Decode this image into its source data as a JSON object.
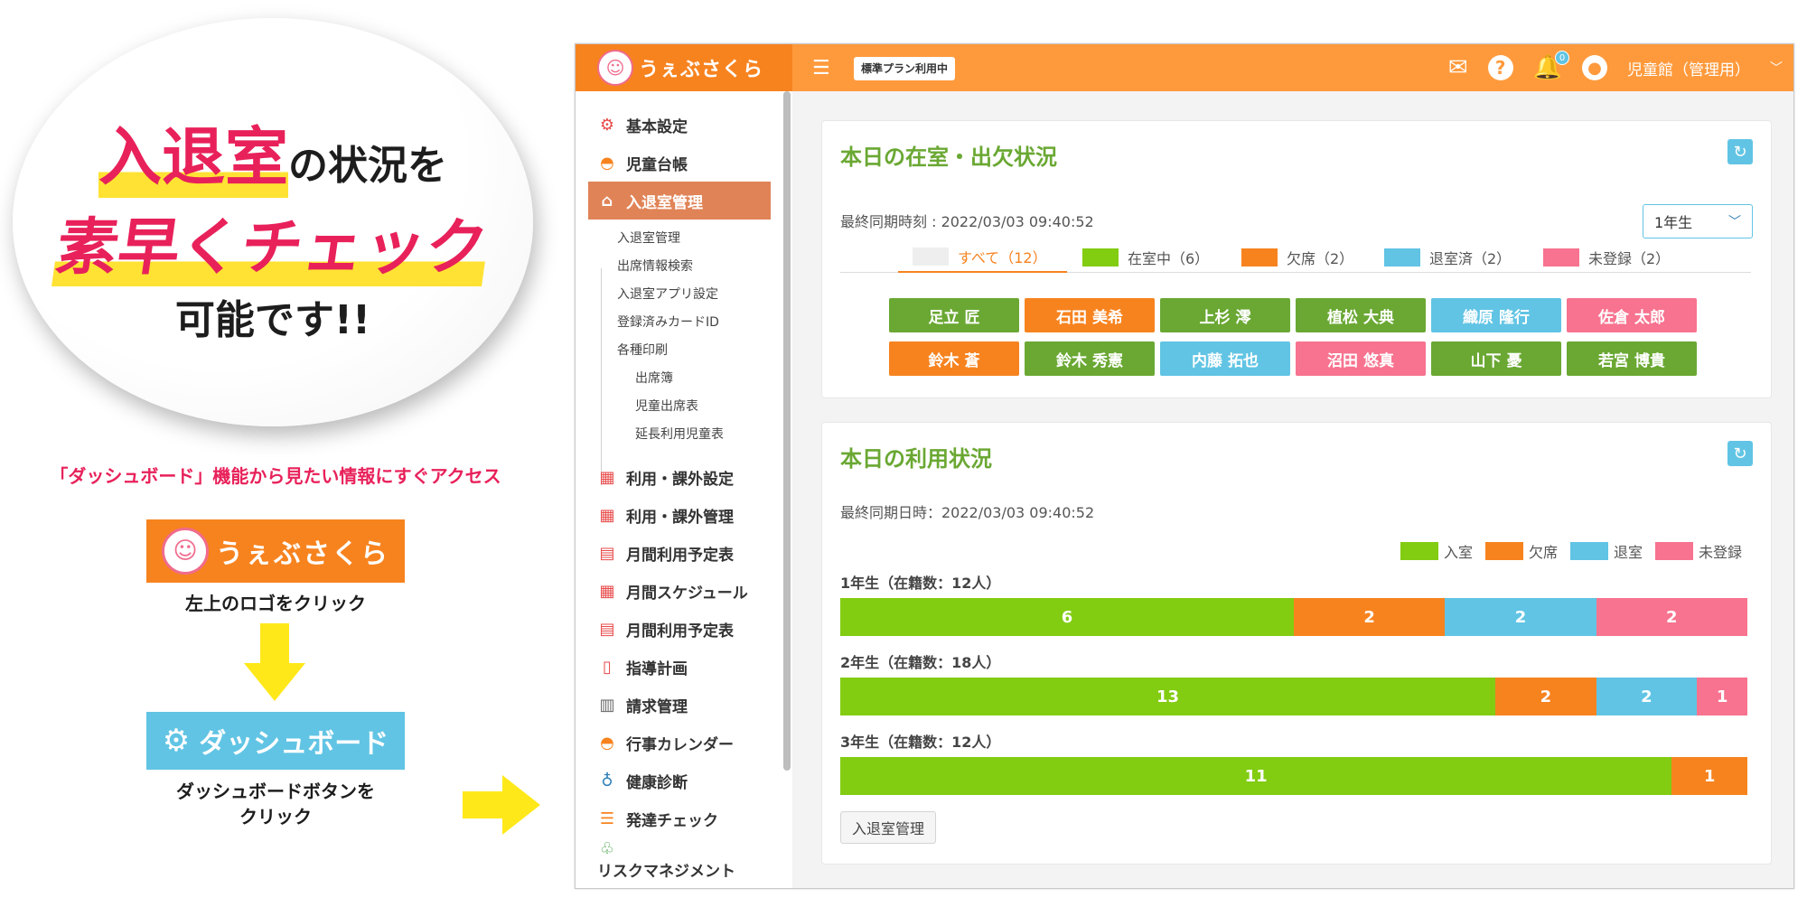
{
  "promo": {
    "line1_big": "入退室",
    "line1_rest": "の状況を",
    "line2": "素早くチェック",
    "line3": "可能です!!",
    "caption": "「ダッシュボード」機能から見たい情報にすぐアクセス",
    "logo_text": "うぇぶさくら",
    "step1": "左上のロゴをクリック",
    "dashboard_button": "ダッシュボード",
    "step2_line1": "ダッシュボードボタンを",
    "step2_line2": "クリック"
  },
  "header": {
    "logo_text": "うぇぶさくら",
    "plan_badge": "標準プラン利用中",
    "notification_count": "0",
    "user_name": "児童館（管理用）"
  },
  "sidebar": {
    "items": [
      {
        "label": "基本設定",
        "icon": "gear-icon"
      },
      {
        "label": "児童台帳",
        "icon": "child-icon"
      },
      {
        "label": "入退室管理",
        "icon": "building-icon"
      }
    ],
    "subitems": [
      "入退室管理",
      "出席情報検索",
      "入退室アプリ設定",
      "登録済みカードID",
      "各種印刷"
    ],
    "subsubitems": [
      "出席簿",
      "児童出席表",
      "延長利用児童表"
    ],
    "items2": [
      {
        "label": "利用・課外設定",
        "icon": "calendar-icon"
      },
      {
        "label": "利用・課外管理",
        "icon": "calendar-icon"
      },
      {
        "label": "月間利用予定表",
        "icon": "calendar-clock-icon"
      },
      {
        "label": "月間スケジュール",
        "icon": "calendar-icon"
      },
      {
        "label": "月間利用予定表",
        "icon": "calendar-clock-icon"
      },
      {
        "label": "指導計画",
        "icon": "notebook-icon"
      },
      {
        "label": "請求管理",
        "icon": "calculator-icon"
      },
      {
        "label": "行事カレンダー",
        "icon": "child-icon"
      },
      {
        "label": "健康診断",
        "icon": "stethoscope-icon"
      },
      {
        "label": "発達チェック",
        "icon": "checklist-icon"
      },
      {
        "label": "リスクマネジメント",
        "icon": "hands-icon"
      }
    ]
  },
  "attendance": {
    "title": "本日の在室・出欠状況",
    "sync_time": "最終同期時刻 : 2022/03/03 09:40:52",
    "grade_select": "1年生",
    "tabs": [
      {
        "label": "すべて（12）",
        "color": "#eeeeee"
      },
      {
        "label": "在室中（6）",
        "color": "#82cc12"
      },
      {
        "label": "欠席（2）",
        "color": "#f7831f"
      },
      {
        "label": "退室済（2）",
        "color": "#61c4e4"
      },
      {
        "label": "未登録（2）",
        "color": "#f7738f"
      }
    ],
    "students": [
      {
        "name": "足立 匠",
        "status": "in-room",
        "color": "#6aa833"
      },
      {
        "name": "石田 美希",
        "status": "absent",
        "color": "#f7831f"
      },
      {
        "name": "上杉 澪",
        "status": "in-room",
        "color": "#6aa833"
      },
      {
        "name": "植松 大典",
        "status": "in-room",
        "color": "#6aa833"
      },
      {
        "name": "織原 隆行",
        "status": "left",
        "color": "#61c4e4"
      },
      {
        "name": "佐倉 太郎",
        "status": "unregistered",
        "color": "#f7738f"
      },
      {
        "name": "鈴木 蒼",
        "status": "absent",
        "color": "#f7831f"
      },
      {
        "name": "鈴木 秀憲",
        "status": "in-room",
        "color": "#6aa833"
      },
      {
        "name": "内藤 拓也",
        "status": "left",
        "color": "#61c4e4"
      },
      {
        "name": "沼田 悠真",
        "status": "unregistered",
        "color": "#f7738f"
      },
      {
        "name": "山下 憂",
        "status": "in-room",
        "color": "#6aa833"
      },
      {
        "name": "若宮 博貴",
        "status": "in-room",
        "color": "#6aa833"
      }
    ]
  },
  "usage": {
    "title": "本日の利用状況",
    "sync_time": "最終同期日時：2022/03/03 09:40:52",
    "legend": [
      {
        "label": "入室",
        "color": "#82cc12"
      },
      {
        "label": "欠席",
        "color": "#f7831f"
      },
      {
        "label": "退室",
        "color": "#61c4e4"
      },
      {
        "label": "未登録",
        "color": "#f7738f"
      }
    ],
    "button_label": "入退室管理"
  },
  "chart_data": {
    "type": "bar",
    "stacked": true,
    "orientation": "horizontal",
    "categories": [
      "1年生（在籍数：12人）",
      "2年生（在籍数：18人）",
      "3年生（在籍数：12人）"
    ],
    "series": [
      {
        "name": "入室",
        "values": [
          6,
          13,
          11
        ],
        "color": "#82cc12"
      },
      {
        "name": "欠席",
        "values": [
          2,
          2,
          1
        ],
        "color": "#f7831f"
      },
      {
        "name": "退室",
        "values": [
          2,
          2,
          0
        ],
        "color": "#61c4e4"
      },
      {
        "name": "未登録",
        "values": [
          2,
          1,
          0
        ],
        "color": "#f7738f"
      }
    ]
  }
}
